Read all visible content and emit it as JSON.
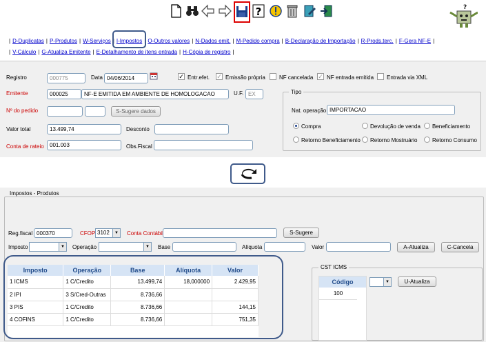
{
  "toolbar": {
    "items": [
      "new-document-icon",
      "binoculars-icon",
      "arrow-left-icon",
      "arrow-right-icon",
      "save-icon",
      "help-icon",
      "warning-icon",
      "trash-icon",
      "edit-icon",
      "exit-icon"
    ]
  },
  "menu": {
    "row1": [
      "D-Duplicatas",
      "P-Produtos",
      "W-Serviços",
      "I-Impostos",
      "O-Outros valores",
      "N-Dados emit.",
      "M-Pedido compra",
      "B-Declaração de Importação",
      "R-Prods.terc.",
      "F-Gera NF-E"
    ],
    "row2": [
      "V-Cálculo",
      "G-Atualiza Emitente",
      "E-Detalhamento de itens entrada",
      "H-Cópia de registro"
    ]
  },
  "form": {
    "registro_label": "Registro",
    "registro_value": "000775",
    "data_label": "Data",
    "data_value": "04/06/2014",
    "entr_efet_label": "Entr.efet.",
    "emissao_propria_label": "Emissão própria",
    "nf_cancelada_label": "NF cancelada",
    "nf_entrada_emitida_label": "NF entrada emitida",
    "entrada_via_xml_label": "Entrada via XML",
    "emitente_label": "Emitente",
    "emitente_code": "000025",
    "emitente_name": "NF-E EMITIDA EM AMBIENTE DE HOMOLOGACAO",
    "uf_label": "U.F.",
    "uf_value": "EX",
    "pedido_label": "Nº do pedido",
    "sugere_dados_label": "S-Sugere dados",
    "valor_total_label": "Valor total",
    "valor_total_value": "13.499,74",
    "desconto_label": "Desconto",
    "conta_rateio_label": "Conta de rateio",
    "conta_rateio_value": "001.003",
    "obs_fiscal_label": "Obs.Fiscal"
  },
  "tipo": {
    "title": "Tipo",
    "nat_operacao_label": "Nat. operação",
    "nat_operacao_value": "IMPORTACAO",
    "options": [
      "Compra",
      "Devolução de venda",
      "Beneficiamento",
      "Retorno Beneficiamento",
      "Retorno Mostruário",
      "Retorno Consumo"
    ],
    "selected": "Compra"
  },
  "impostos": {
    "title": "Impostos - Produtos",
    "reg_fiscal_label": "Reg.fiscal",
    "reg_fiscal_value": "000370",
    "cfop_label": "CFOP",
    "cfop_value": "3102",
    "conta_contabil_label": "Conta Contábil",
    "sugere_label": "S-Sugere",
    "imposto_label": "Imposto",
    "operacao_label": "Operação",
    "base_label": "Base",
    "aliquota_label": "Alíquota",
    "valor_label": "Valor",
    "atualiza_label": "A-Atualiza",
    "cancela_label": "C-Cancela",
    "columns": [
      "Imposto",
      "Operação",
      "Base",
      "Alíquota",
      "Valor"
    ],
    "rows": [
      [
        "1 ICMS",
        "1 C/Credito",
        "13.499,74",
        "18,000000",
        "2.429,95"
      ],
      [
        "2 IPI",
        "3 S/Cred-Outras",
        "8.736,66",
        "",
        ""
      ],
      [
        "3 PIS",
        "1 C/Credito",
        "8.736,66",
        "",
        "144,15"
      ],
      [
        "4 COFINS",
        "1 C/Credito",
        "8.736,66",
        "",
        "751,35"
      ]
    ]
  },
  "cst": {
    "title": "CST ICMS",
    "column": "Código",
    "value": "100",
    "atualiza_label": "U-Atualiza"
  }
}
